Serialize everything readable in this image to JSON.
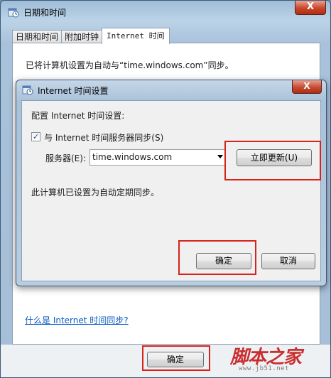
{
  "window": {
    "title": "日期和时间",
    "close": "X"
  },
  "tabs": [
    "日期和时间",
    "附加时钟",
    "Internet 时间"
  ],
  "panel": {
    "status_text": "已将计算机设置为自动与“time.windows.com”同步。",
    "help_link": "什么是 Internet 时间同步?"
  },
  "footer": {
    "ok": "确定"
  },
  "dialog": {
    "title": "Internet 时间设置",
    "close": "X",
    "heading": "配置 Internet 时间设置:",
    "sync_checkbox_label": "与 Internet 时间服务器同步(S)",
    "sync_checked": true,
    "server_label": "服务器(E):",
    "server_value": "time.windows.com",
    "update_now": "立即更新(U)",
    "status": "此计算机已设置为自动定期同步。",
    "ok": "确定",
    "cancel": "取消"
  },
  "watermark": {
    "main": "脚本之家",
    "sub": "www.jb51.net"
  },
  "colors": {
    "highlight": "#d8221a",
    "link": "#0b5cc2"
  }
}
